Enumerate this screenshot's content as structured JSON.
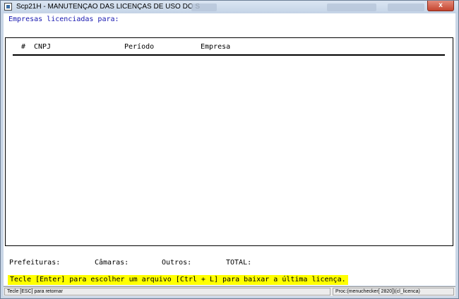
{
  "window": {
    "title": "Scp21H - MANUTENÇÃO DAS LICENÇAS DE USO DO SISTEMA ...",
    "close_label": "x"
  },
  "main": {
    "heading": "Empresas licenciadas para:",
    "table": {
      "columns": [
        "#",
        "CNPJ",
        "Período",
        "Empresa"
      ],
      "rows": []
    },
    "totals": {
      "prefeituras_label": "Prefeituras:",
      "camaras_label": "Câmaras:",
      "outros_label": "Outros:",
      "total_label": "TOTAL:"
    },
    "hint": "Tecle [Enter] para escolher um arquivo [Ctrl + L] para baixar a última licença."
  },
  "statusbar": {
    "left": "Tecle [ESC] para retornar",
    "right": "Proc:(menuchecker[ 2820])(cl_licenca)"
  },
  "colors": {
    "heading": "#1818b0",
    "hint_background": "#ffff00",
    "close_button": "#c4452f"
  }
}
